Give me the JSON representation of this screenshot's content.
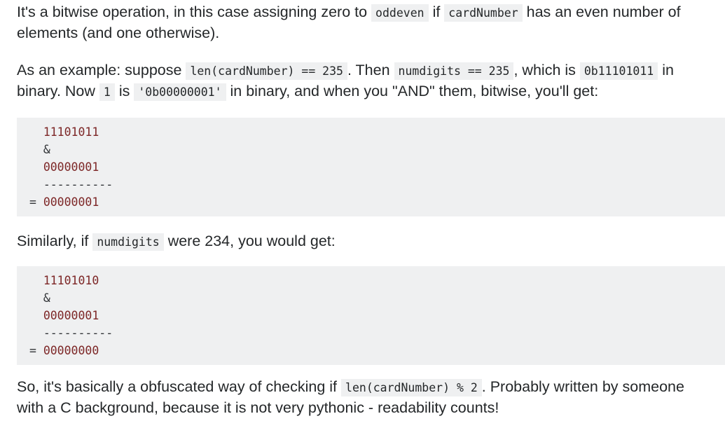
{
  "p1": {
    "t1": "It's a bitwise operation, in this case assigning zero to ",
    "c1": "oddeven",
    "t2": " if ",
    "c2": "cardNumber",
    "t3": " has an even number of",
    "t4": "elements (and one otherwise)."
  },
  "p2": {
    "t1": "As an example: suppose ",
    "c1": "len(cardNumber) == 235",
    "t2": ". Then ",
    "c2": "numdigits == 235",
    "t3": ", which is ",
    "c3": "0b11101011",
    "t4": " in",
    "t5": "binary. Now ",
    "c4": "1",
    "t6": " is ",
    "c5": "'0b00000001'",
    "t7": " in binary, and when you \"AND\" them, bitwise, you'll get:"
  },
  "code1": {
    "a": "11101011",
    "op": "&",
    "b": "00000001",
    "dashes": "----------",
    "eq": "= ",
    "result": "00000001"
  },
  "p3": {
    "t1": "Similarly, if ",
    "c1": "numdigits",
    "t2": " were 234, you would get:"
  },
  "code2": {
    "a": "11101010",
    "op": "&",
    "b": "00000001",
    "dashes": "----------",
    "eq": "= ",
    "result": "00000000"
  },
  "p4": {
    "t1": "So, it's basically a obfuscated way of checking if ",
    "c1": "len(cardNumber) % 2",
    "t2": ". Probably written by someone",
    "t3": "with a C background, because it is not very pythonic - readability counts!"
  }
}
